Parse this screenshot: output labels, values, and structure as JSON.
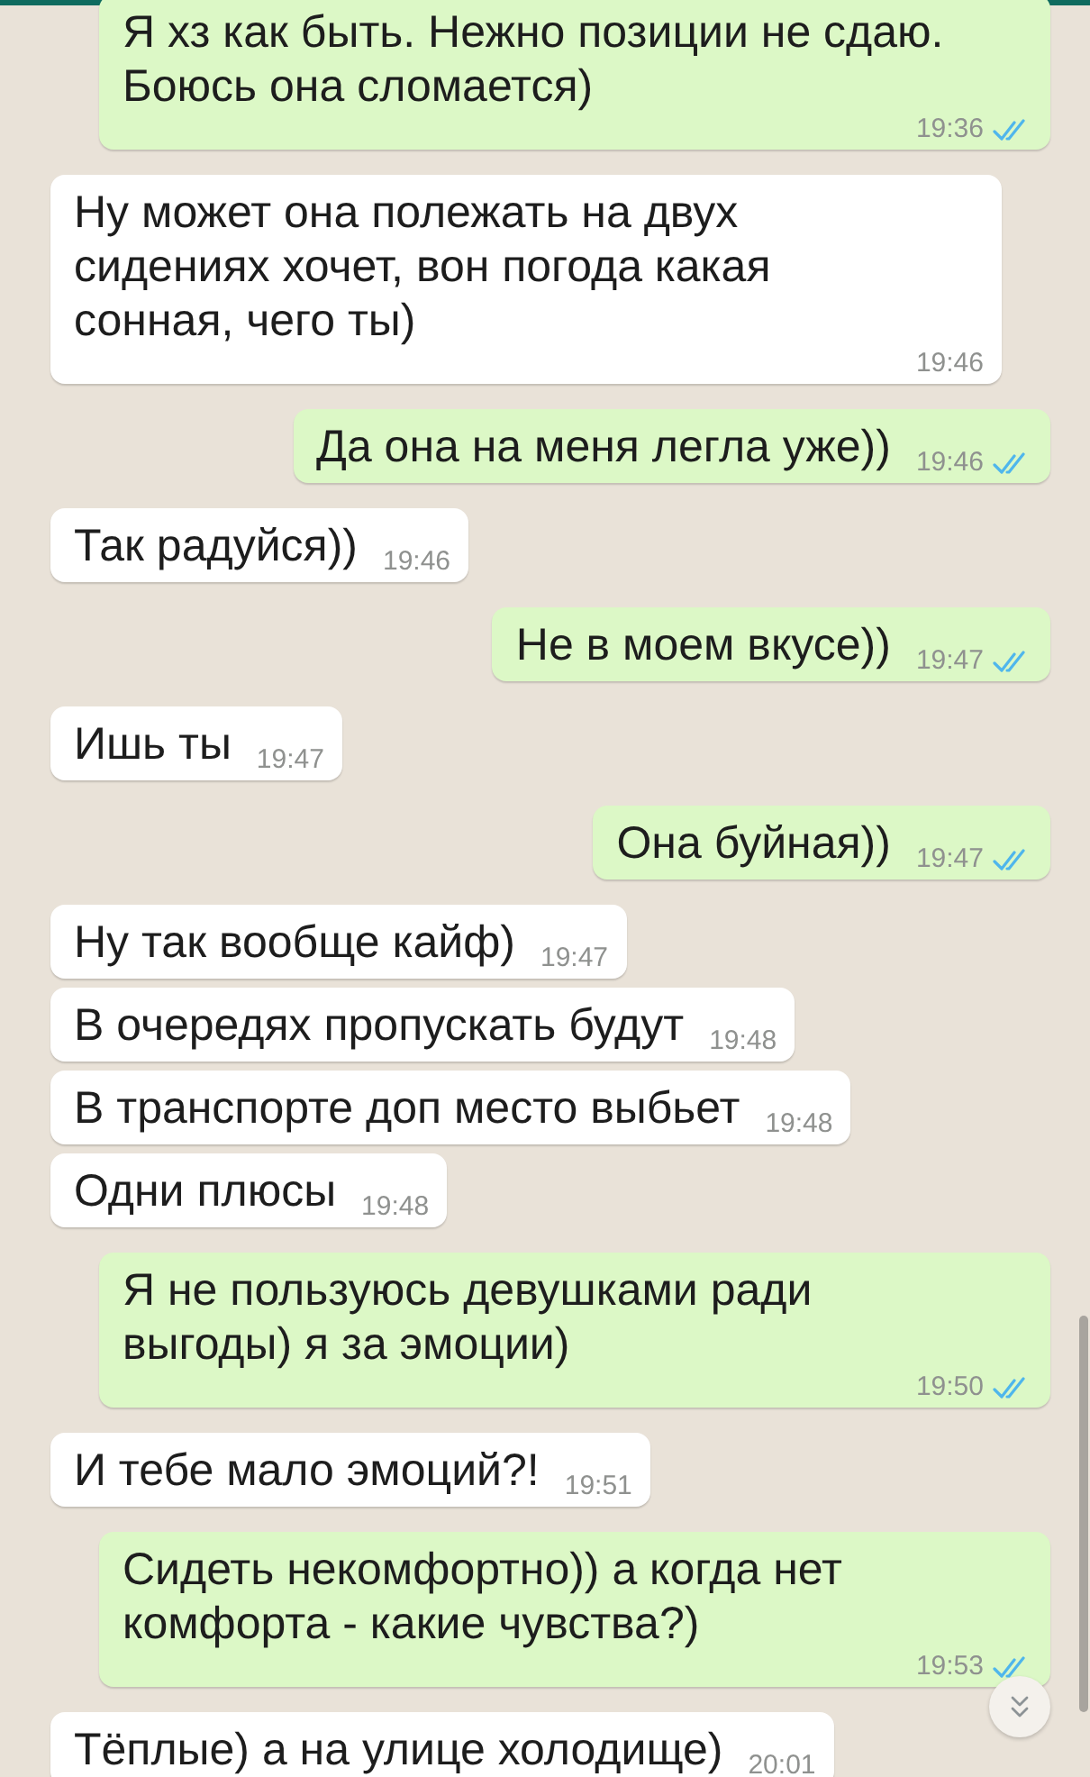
{
  "messages": [
    {
      "kind": "outgoing",
      "text": "Я хз как быть. Нежно позиции не сдаю. Боюсь она сломается)",
      "time": "19:36",
      "read": true
    },
    {
      "kind": "incoming",
      "text": "Ну может она полежать на двух сидениях хочет, вон погода какая сонная, чего ты)",
      "time": "19:46"
    },
    {
      "kind": "outgoing",
      "text": "Да она на меня легла уже))",
      "time": "19:46",
      "read": true
    },
    {
      "kind": "incoming",
      "text": "Так радуйся))",
      "time": "19:46"
    },
    {
      "kind": "outgoing",
      "text": "Не в моем вкусе))",
      "time": "19:47",
      "read": true
    },
    {
      "kind": "incoming",
      "text": "Ишь ты",
      "time": "19:47"
    },
    {
      "kind": "outgoing",
      "text": "Она буйная))",
      "time": "19:47",
      "read": true
    },
    {
      "kind": "incoming",
      "text": "Ну так вообще кайф)",
      "time": "19:47"
    },
    {
      "kind": "incoming",
      "text": "В очередях пропускать будут",
      "time": "19:48"
    },
    {
      "kind": "incoming",
      "text": "В транспорте доп место выбьет",
      "time": "19:48"
    },
    {
      "kind": "incoming",
      "text": "Одни плюсы",
      "time": "19:48"
    },
    {
      "kind": "outgoing",
      "text": "Я не пользуюсь девушками ради выгоды) я за эмоции)",
      "time": "19:50",
      "read": true
    },
    {
      "kind": "incoming",
      "text": "И тебе мало эмоций?!",
      "time": "19:51"
    },
    {
      "kind": "outgoing",
      "text": "Сидеть некомфортно)) а когда нет комфорта - какие чувства?)",
      "time": "19:53",
      "read": true
    },
    {
      "kind": "incoming",
      "text": "Тёплые) а на улице холодище)",
      "time": "20:01"
    }
  ]
}
